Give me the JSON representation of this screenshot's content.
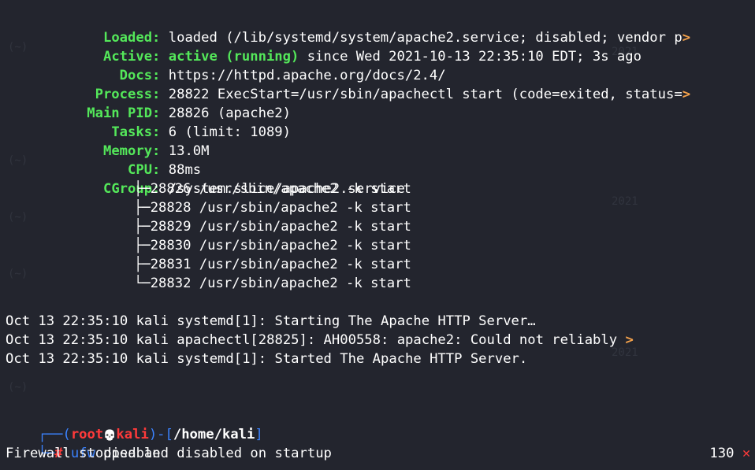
{
  "status": {
    "rows": [
      {
        "key": "Loaded:",
        "value": "loaded (/lib/systemd/system/apache2.service; disabled; vendor p",
        "trunc": ">"
      },
      {
        "key": "Active:",
        "active": "active (running)",
        "value": " since Wed 2021-10-13 22:35:10 EDT; 3s ago"
      },
      {
        "key": "Docs:",
        "value": "https://httpd.apache.org/docs/2.4/"
      },
      {
        "key": "Process:",
        "value": "28822 ExecStart=/usr/sbin/apachectl start (code=exited, status=",
        "trunc": ">"
      },
      {
        "key": "Main PID:",
        "value": "28826 (apache2)"
      },
      {
        "key": "Tasks:",
        "value": "6 (limit: 1089)"
      },
      {
        "key": "Memory:",
        "value": "13.0M"
      },
      {
        "key": "CPU:",
        "value": "88ms"
      },
      {
        "key": "CGroup:",
        "value": "/system.slice/apache2.service"
      }
    ],
    "cgroup_tree": [
      "├─28826 /usr/sbin/apache2 -k start",
      "├─28828 /usr/sbin/apache2 -k start",
      "├─28829 /usr/sbin/apache2 -k start",
      "├─28830 /usr/sbin/apache2 -k start",
      "├─28831 /usr/sbin/apache2 -k start",
      "└─28832 /usr/sbin/apache2 -k start"
    ]
  },
  "journal": [
    {
      "text": "Oct 13 22:35:10 kali systemd[1]: Starting The Apache HTTP Server…",
      "trunc": ""
    },
    {
      "text": "Oct 13 22:35:10 kali apachectl[28825]: AH00558: apache2: Could not reliably ",
      "trunc": ">"
    },
    {
      "text": "Oct 13 22:35:10 kali systemd[1]: Started The Apache HTTP Server.",
      "trunc": ""
    }
  ],
  "prompt": {
    "top_left": "┌──(",
    "user": "root",
    "skull": "💀",
    "host": "kali",
    "mid": ")-[",
    "path": "/home/kali",
    "end": "]",
    "bottom_left": "└─",
    "hash": "#",
    "command_name": "ufw",
    "command_args": " disable",
    "exit_code": "130",
    "exit_icon": "✕"
  },
  "output": "Firewall stopped and disabled on startup",
  "ghosts": {
    "tilde": "(~)",
    "year": "2021"
  },
  "colors": {
    "background": "#23252e",
    "key_green": "#54e85a",
    "accent_blue": "#3b83ff",
    "root_red": "#ff3a3a",
    "trunc_orange": "#f5a24b"
  }
}
